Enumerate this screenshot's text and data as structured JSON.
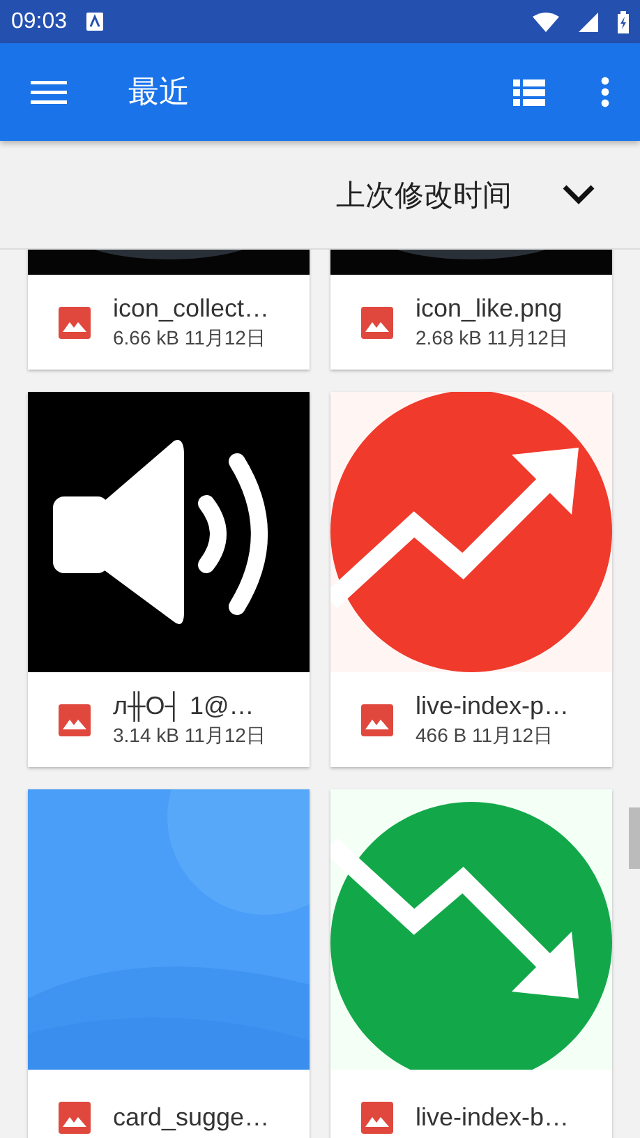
{
  "status_bar": {
    "time": "09:03"
  },
  "app_bar": {
    "title": "最近"
  },
  "sort_bar": {
    "label": "上次修改时间"
  },
  "files": [
    {
      "name": "icon_collect…",
      "meta": "6.66 kB 11月12日"
    },
    {
      "name": "icon_like.png",
      "meta": "2.68 kB 11月12日"
    },
    {
      "name": "л╫О┤  1@…",
      "meta": "3.14 kB 11月12日"
    },
    {
      "name": "live-index-p…",
      "meta": "466 B 11月12日"
    },
    {
      "name": "card_sugge…"
    },
    {
      "name": "live-index-b…"
    }
  ]
}
